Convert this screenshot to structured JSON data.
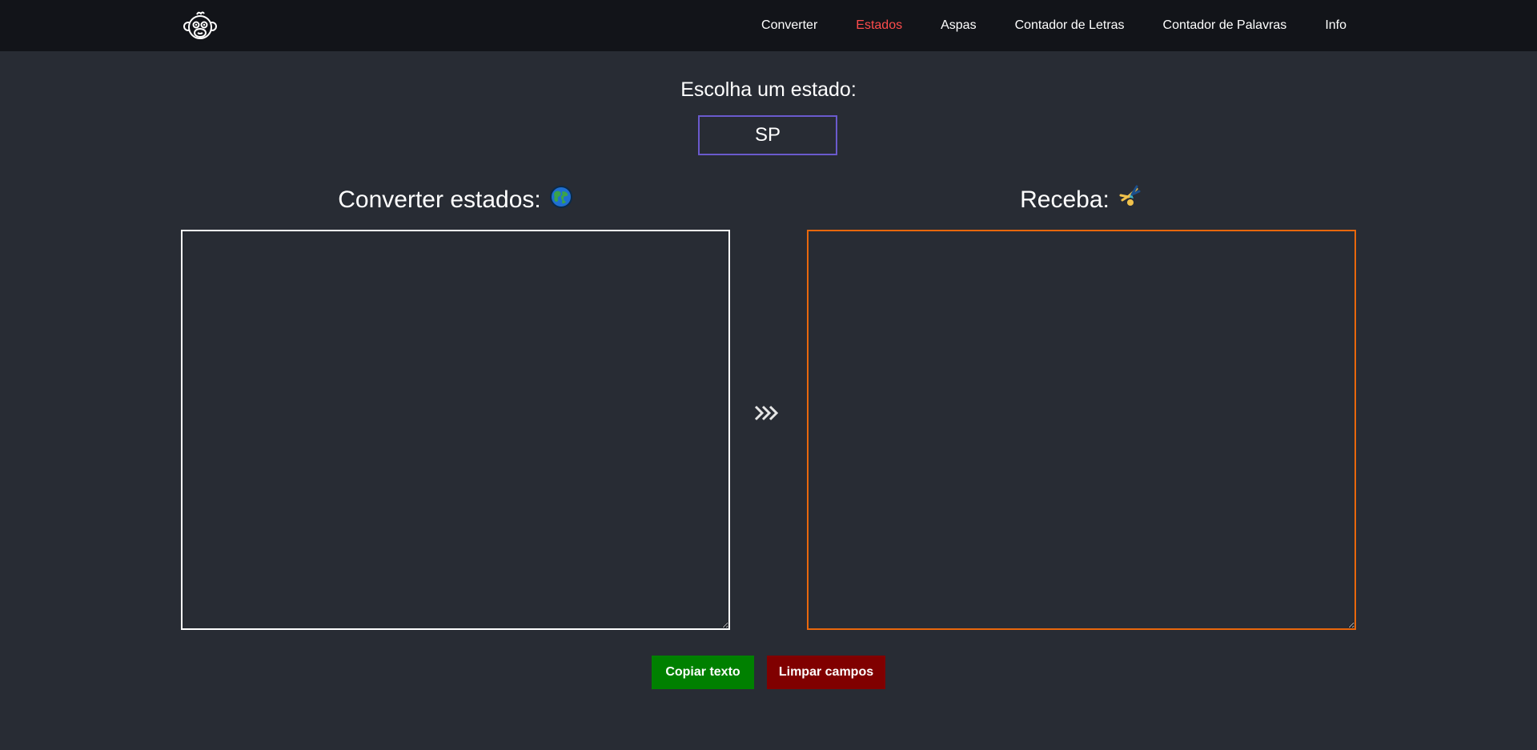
{
  "nav": {
    "logo_icon": "monkey-face-icon",
    "links": [
      {
        "label": "Converter",
        "active": false
      },
      {
        "label": "Estados",
        "active": true
      },
      {
        "label": "Aspas",
        "active": false
      },
      {
        "label": "Contador de Letras",
        "active": false
      },
      {
        "label": "Contador de Palavras",
        "active": false
      },
      {
        "label": "Info",
        "active": false
      }
    ],
    "active_color": "#ff4c4c"
  },
  "state_picker": {
    "label": "Escolha um estado:",
    "value": "SP"
  },
  "converter": {
    "input_title": "Converter estados:",
    "input_icon": "globe-icon",
    "input_value": "",
    "output_title": "Receba:",
    "output_icon": "cartwheel-person-icon",
    "output_value": "",
    "arrow_icon": "triple-chevron-right-icon"
  },
  "actions": {
    "copy_label": "Copiar texto",
    "clear_label": "Limpar campos"
  },
  "colors": {
    "background": "#282c34",
    "navbar": "#121419",
    "input_border": "#ffffff",
    "output_border": "#e8670c",
    "state_border": "#6a5acd",
    "copy_button": "#008000",
    "clear_button": "#800000"
  }
}
